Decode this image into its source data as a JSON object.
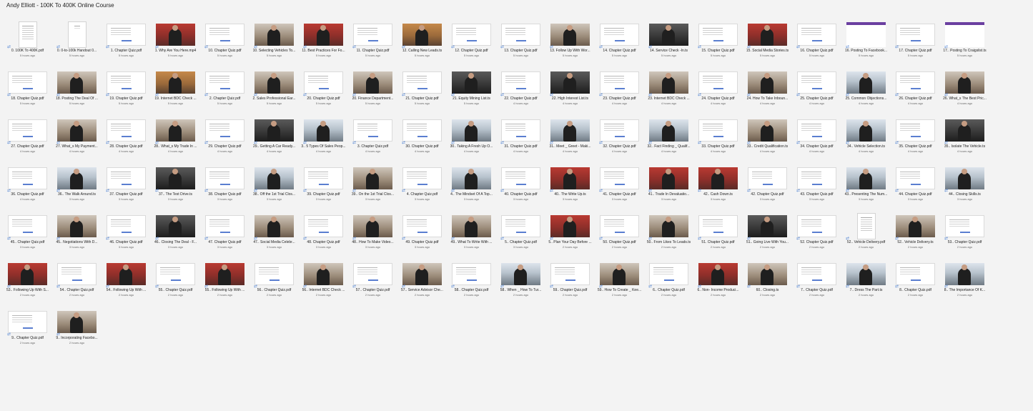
{
  "window": {
    "title": "Andy Elliott - 100K To 400K Online Course"
  },
  "icons": {
    "sync": "sync-arrows-icon"
  },
  "files": [
    {
      "name": "0. 100K To 400K.pdf",
      "time": "5 hours ago",
      "thumb": "page"
    },
    {
      "name": "0. 0-to-100k Handout 0...",
      "time": "5 hours ago",
      "thumb": "page"
    },
    {
      "name": "1. Chapter Quiz.pdf",
      "time": "5 hours ago",
      "thumb": "doc"
    },
    {
      "name": "1. Why Are You Here.mp4",
      "time": "5 hours ago",
      "thumb": "vid red"
    },
    {
      "name": "10. Chapter Quiz.pdf",
      "time": "5 hours ago",
      "thumb": "doc"
    },
    {
      "name": "10. Selecting Vehicles To...",
      "time": "5 hours ago",
      "thumb": "vid"
    },
    {
      "name": "11. Best Practices For Fo...",
      "time": "5 hours ago",
      "thumb": "vid red"
    },
    {
      "name": "11. Chapter Quiz.pdf",
      "time": "5 hours ago",
      "thumb": "doc"
    },
    {
      "name": "12. Calling New Leads.ts",
      "time": "5 hours ago",
      "thumb": "vid wood"
    },
    {
      "name": "12. Chapter Quiz.pdf",
      "time": "5 hours ago",
      "thumb": "doc"
    },
    {
      "name": "13. Chapter Quiz.pdf",
      "time": "5 hours ago",
      "thumb": "doc"
    },
    {
      "name": "13. Follow Up With Wor...",
      "time": "5 hours ago",
      "thumb": "vid"
    },
    {
      "name": "14. Chapter Quiz.pdf",
      "time": "5 hours ago",
      "thumb": "doc"
    },
    {
      "name": "14. Service Check -In.ts",
      "time": "5 hours ago",
      "thumb": "vid dark"
    },
    {
      "name": "15. Chapter Quiz.pdf",
      "time": "5 hours ago",
      "thumb": "doc"
    },
    {
      "name": "15. Social Media Stories.ts",
      "time": "5 hours ago",
      "thumb": "vid red"
    },
    {
      "name": "16. Chapter Quiz.pdf",
      "time": "5 hours ago",
      "thumb": "doc"
    },
    {
      "name": "16. Posting To Facebook...",
      "time": "5 hours ago",
      "thumb": "vid site"
    },
    {
      "name": "17. Chapter Quiz.pdf",
      "time": "5 hours ago",
      "thumb": "doc"
    },
    {
      "name": "17.. Posting To Craigslist.ts",
      "time": "5 hours ago",
      "thumb": "vid site"
    },
    {
      "name": "",
      "time": "",
      "thumb": "none"
    },
    {
      "name": "18. Chapter Quiz.pdf",
      "time": "5 hours ago",
      "thumb": "doc"
    },
    {
      "name": "18. Posting The Deal Of ...",
      "time": "5 hours ago",
      "thumb": "vid"
    },
    {
      "name": "19. Chapter Quiz.pdf",
      "time": "5 hours ago",
      "thumb": "doc"
    },
    {
      "name": "19. Internet BDC Check ...",
      "time": "5 hours ago",
      "thumb": "vid wood"
    },
    {
      "name": "2. Chapter Quiz.pdf",
      "time": "5 hours ago",
      "thumb": "doc"
    },
    {
      "name": "2. Sales Professional Ear...",
      "time": "5 hours ago",
      "thumb": "vid"
    },
    {
      "name": "20. Chapter Quiz.pdf",
      "time": "5 hours ago",
      "thumb": "doc"
    },
    {
      "name": "20. Finance Department...",
      "time": "5 hours ago",
      "thumb": "vid"
    },
    {
      "name": "21. Chapter Quiz.pdf",
      "time": "5 hours ago",
      "thumb": "doc"
    },
    {
      "name": "21. Equity Mining List.ts",
      "time": "5 hours ago",
      "thumb": "vid dark"
    },
    {
      "name": "22. Chapter Quiz.pdf",
      "time": "4 hours ago",
      "thumb": "doc"
    },
    {
      "name": "22. High Interest List.ts",
      "time": "4 hours ago",
      "thumb": "vid dark"
    },
    {
      "name": "23. Chapter Quiz.pdf",
      "time": "4 hours ago",
      "thumb": "doc"
    },
    {
      "name": "23. Internet BDC Check ...",
      "time": "4 hours ago",
      "thumb": "vid"
    },
    {
      "name": "24. Chapter Quiz.pdf",
      "time": "4 hours ago",
      "thumb": "doc"
    },
    {
      "name": "24. How To Take Inboun...",
      "time": "4 hours ago",
      "thumb": "vid"
    },
    {
      "name": "25. Chapter Quiz.pdf",
      "time": "4 hours ago",
      "thumb": "doc"
    },
    {
      "name": "25. Common Objections...",
      "time": "4 hours ago",
      "thumb": "vid lot"
    },
    {
      "name": "26. Chapter Quiz.pdf",
      "time": "4 hours ago",
      "thumb": "doc"
    },
    {
      "name": "26. What_s The Best Pric...",
      "time": "4 hours ago",
      "thumb": "vid"
    },
    {
      "name": "",
      "time": "",
      "thumb": "none"
    },
    {
      "name": "27. Chapter Quiz.pdf",
      "time": "4 hours ago",
      "thumb": "doc"
    },
    {
      "name": "27. What_s My Payment...",
      "time": "4 hours ago",
      "thumb": "vid"
    },
    {
      "name": "28. Chapter Quiz.pdf",
      "time": "4 hours ago",
      "thumb": "doc"
    },
    {
      "name": "28.. What_s My Trade In ...",
      "time": "4 hours ago",
      "thumb": "vid"
    },
    {
      "name": "29. Chapter Quiz.pdf",
      "time": "4 hours ago",
      "thumb": "doc"
    },
    {
      "name": "29.. Getting A Car Ready...",
      "time": "4 hours ago",
      "thumb": "vid dark"
    },
    {
      "name": "3.. 5 Types Of Sales Peop...",
      "time": "4 hours ago",
      "thumb": "vid lot"
    },
    {
      "name": "3. Chapter Quiz.pdf",
      "time": "4 hours ago",
      "thumb": "doc"
    },
    {
      "name": "30. Chapter Quiz.pdf",
      "time": "4 hours ago",
      "thumb": "doc"
    },
    {
      "name": "30.. Taking A Fresh Up O...",
      "time": "4 hours ago",
      "thumb": "vid lot"
    },
    {
      "name": "31. Chapter Quiz.pdf",
      "time": "4 hours ago",
      "thumb": "doc"
    },
    {
      "name": "31.. Meet _ Greet - Maki...",
      "time": "4 hours ago",
      "thumb": "vid lot"
    },
    {
      "name": "32. Chapter Quiz.pdf",
      "time": "4 hours ago",
      "thumb": "doc"
    },
    {
      "name": "32.. Fact Finding _ Qualif...",
      "time": "4 hours ago",
      "thumb": "vid lot"
    },
    {
      "name": "33. Chapter Quiz.pdf",
      "time": "4 hours ago",
      "thumb": "doc"
    },
    {
      "name": "33.. Credit Qualification.ts",
      "time": "4 hours ago",
      "thumb": "vid"
    },
    {
      "name": "34. Chapter Quiz.pdf",
      "time": "4 hours ago",
      "thumb": "doc"
    },
    {
      "name": "34.. Vehicle Selection.ts",
      "time": "4 hours ago",
      "thumb": "vid lot"
    },
    {
      "name": "35. Chapter Quiz.pdf",
      "time": "4 hours ago",
      "thumb": "doc"
    },
    {
      "name": "35.. Isolate The Vehicle.ts",
      "time": "4 hours ago",
      "thumb": "vid dark"
    },
    {
      "name": "",
      "time": "",
      "thumb": "none"
    },
    {
      "name": "36. Chapter Quiz.pdf",
      "time": "4 hours ago",
      "thumb": "doc"
    },
    {
      "name": "36.. The Walk Around.ts",
      "time": "3 hours ago",
      "thumb": "vid lot"
    },
    {
      "name": "37. Chapter Quiz.pdf",
      "time": "3 hours ago",
      "thumb": "doc"
    },
    {
      "name": "37.. The Test Drive.ts",
      "time": "3 hours ago",
      "thumb": "vid dark"
    },
    {
      "name": "38. Chapter Quiz.pdf",
      "time": "3 hours ago",
      "thumb": "doc"
    },
    {
      "name": "38.. Off the 1st Trial Clos...",
      "time": "3 hours ago",
      "thumb": "vid lot"
    },
    {
      "name": "39. Chapter Quiz.pdf",
      "time": "3 hours ago",
      "thumb": "doc"
    },
    {
      "name": "39.. On the 1st Trial Clos...",
      "time": "3 hours ago",
      "thumb": "vid"
    },
    {
      "name": "4. Chapter Quiz.pdf",
      "time": "3 hours ago",
      "thumb": "doc"
    },
    {
      "name": "4.. The Mindset Of A Top...",
      "time": "3 hours ago",
      "thumb": "vid lot"
    },
    {
      "name": "40. Chapter Quiz.pdf",
      "time": "3 hours ago",
      "thumb": "doc"
    },
    {
      "name": "40.. The Write Up.ts",
      "time": "3 hours ago",
      "thumb": "vid red"
    },
    {
      "name": "41. Chapter Quiz.pdf",
      "time": "3 hours ago",
      "thumb": "doc"
    },
    {
      "name": "41.. Trade In Devaluatio...",
      "time": "3 hours ago",
      "thumb": "vid red"
    },
    {
      "name": "42.. Cash Down.ts",
      "time": "3 hours ago",
      "thumb": "vid red"
    },
    {
      "name": "42. Chapter Quiz.pdf",
      "time": "3 hours ago",
      "thumb": "doc"
    },
    {
      "name": "43. Chapter Quiz.pdf",
      "time": "3 hours ago",
      "thumb": "doc"
    },
    {
      "name": "43.. Presenting The Num...",
      "time": "3 hours ago",
      "thumb": "vid lot"
    },
    {
      "name": "44. Chapter Quiz.pdf",
      "time": "3 hours ago",
      "thumb": "doc"
    },
    {
      "name": "44.. Closing Skills.ts",
      "time": "3 hours ago",
      "thumb": "vid lot"
    },
    {
      "name": "",
      "time": "",
      "thumb": "none"
    },
    {
      "name": "45.. Chapter Quiz.pdf",
      "time": "3 hours ago",
      "thumb": "doc"
    },
    {
      "name": "45.. Negotiations With D...",
      "time": "3 hours ago",
      "thumb": "vid"
    },
    {
      "name": "46. Chapter Quiz.pdf",
      "time": "3 hours ago",
      "thumb": "doc"
    },
    {
      "name": "46.. Closing The Deal - F...",
      "time": "3 hours ago",
      "thumb": "vid dark"
    },
    {
      "name": "47. Chapter Quiz.pdf",
      "time": "3 hours ago",
      "thumb": "doc"
    },
    {
      "name": "47.. Social Media Celebr...",
      "time": "3 hours ago",
      "thumb": "vid"
    },
    {
      "name": "48. Chapter Quiz.pdf",
      "time": "3 hours ago",
      "thumb": "doc"
    },
    {
      "name": "48.. How To Make Video...",
      "time": "3 hours ago",
      "thumb": "vid"
    },
    {
      "name": "49. Chapter Quiz.pdf",
      "time": "3 hours ago",
      "thumb": "doc"
    },
    {
      "name": "49.. What To Write With ...",
      "time": "3 hours ago",
      "thumb": "vid"
    },
    {
      "name": "5.. Chapter Quiz.pdf",
      "time": "3 hours ago",
      "thumb": "doc"
    },
    {
      "name": "5.. Plan Your Day Before ...",
      "time": "2 hours ago",
      "thumb": "vid red"
    },
    {
      "name": "50. Chapter Quiz.pdf",
      "time": "2 hours ago",
      "thumb": "doc"
    },
    {
      "name": "50.. From Likes To Leads.ts",
      "time": "2 hours ago",
      "thumb": "vid"
    },
    {
      "name": "51. Chapter Quiz.pdf",
      "time": "2 hours ago",
      "thumb": "doc"
    },
    {
      "name": "51.. Going Live With You...",
      "time": "2 hours ago",
      "thumb": "vid dark"
    },
    {
      "name": "52. Chapter Quiz.pdf",
      "time": "2 hours ago",
      "thumb": "doc"
    },
    {
      "name": "52.. Vehicle Delivery.pdf",
      "time": "2 hours ago",
      "thumb": "page"
    },
    {
      "name": "52.. Vehicle Delivery.ts",
      "time": "2 hours ago",
      "thumb": "vid"
    },
    {
      "name": "53.. Chapter Quiz.pdf",
      "time": "2 hours ago",
      "thumb": "doc"
    },
    {
      "name": "",
      "time": "",
      "thumb": "none"
    },
    {
      "name": "53.. Following Up With S...",
      "time": "2 hours ago",
      "thumb": "vid red"
    },
    {
      "name": "54.. Chapter Quiz.pdf",
      "time": "2 hours ago",
      "thumb": "doc"
    },
    {
      "name": "54.. Following Up With ...",
      "time": "2 hours ago",
      "thumb": "vid red"
    },
    {
      "name": "55.. Chapter Quiz.pdf",
      "time": "2 hours ago",
      "thumb": "doc"
    },
    {
      "name": "55.. Following Up With ...",
      "time": "2 hours ago",
      "thumb": "vid red"
    },
    {
      "name": "56.. Chapter Quiz.pdf",
      "time": "2 hours ago",
      "thumb": "doc"
    },
    {
      "name": "56.. Internet BDC Check ...",
      "time": "2 hours ago",
      "thumb": "vid"
    },
    {
      "name": "57.. Chapter Quiz.pdf",
      "time": "2 hours ago",
      "thumb": "doc"
    },
    {
      "name": "57.. Service Advisor Che...",
      "time": "2 hours ago",
      "thumb": "vid"
    },
    {
      "name": "58.. Chapter Quiz.pdf",
      "time": "2 hours ago",
      "thumb": "doc"
    },
    {
      "name": "58.. When _ How To Tur...",
      "time": "2 hours ago",
      "thumb": "vid lot"
    },
    {
      "name": "59.. Chapter Quiz.pdf",
      "time": "2 hours ago",
      "thumb": "doc"
    },
    {
      "name": "59.. How To Create _ Kee...",
      "time": "2 hours ago",
      "thumb": "vid"
    },
    {
      "name": "6.. Chapter Quiz.pdf",
      "time": "2 hours ago",
      "thumb": "doc"
    },
    {
      "name": "6.. Non- Income Produci...",
      "time": "2 hours ago",
      "thumb": "vid red"
    },
    {
      "name": "60.. Closing.ts",
      "time": "2 hours ago",
      "thumb": "vid"
    },
    {
      "name": "7.. Chapter Quiz.pdf",
      "time": "2 hours ago",
      "thumb": "doc"
    },
    {
      "name": "7.. Dress The Part.ts",
      "time": "2 hours ago",
      "thumb": "vid lot"
    },
    {
      "name": "8.. Chapter Quiz.pdf",
      "time": "2 hours ago",
      "thumb": "doc"
    },
    {
      "name": "8.. The Importance Of K...",
      "time": "2 hours ago",
      "thumb": "vid lot"
    },
    {
      "name": "",
      "time": "",
      "thumb": "none"
    },
    {
      "name": "9.. Chapter Quiz.pdf",
      "time": "2 hours ago",
      "thumb": "doc"
    },
    {
      "name": "9.. Incorporating Facebo...",
      "time": "2 hours ago",
      "thumb": "vid"
    }
  ]
}
